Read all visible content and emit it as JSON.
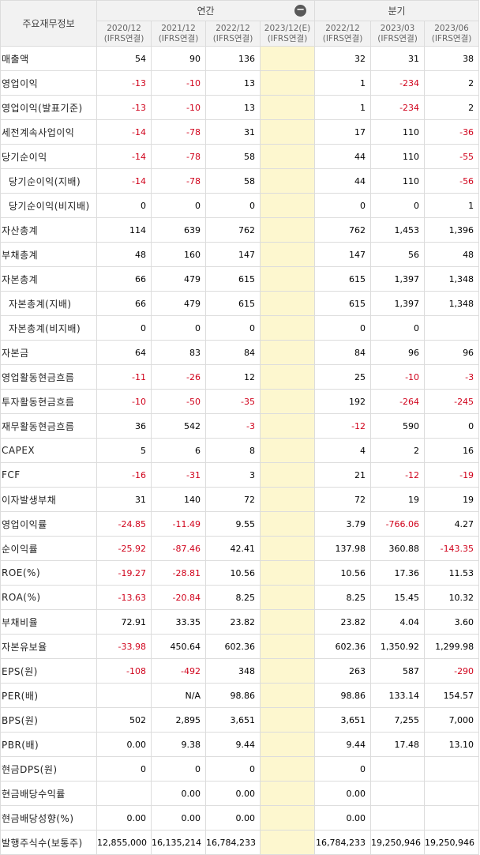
{
  "header": {
    "title": "주요재무정보",
    "annual_label": "연간",
    "quarter_label": "분기",
    "collapse_icon": "minus-circle-icon",
    "periods": [
      {
        "date": "2020/12",
        "basis": "(IFRS연결)"
      },
      {
        "date": "2021/12",
        "basis": "(IFRS연결)"
      },
      {
        "date": "2022/12",
        "basis": "(IFRS연결)"
      },
      {
        "date": "2023/12(E)",
        "basis": "(IFRS연결)"
      },
      {
        "date": "2022/12",
        "basis": "(IFRS연결)"
      },
      {
        "date": "2023/03",
        "basis": "(IFRS연결)"
      },
      {
        "date": "2023/06",
        "basis": "(IFRS연결)"
      }
    ]
  },
  "colors": {
    "negative": "#d0021b",
    "estimate_bg": "#fdf7cf",
    "header_bg": "#f2f2f2"
  },
  "rows": [
    {
      "label": "매출액",
      "indent": false,
      "values": [
        "54",
        "90",
        "136",
        "",
        "32",
        "31",
        "38"
      ]
    },
    {
      "label": "영업이익",
      "indent": false,
      "values": [
        "-13",
        "-10",
        "13",
        "",
        "1",
        "-234",
        "2"
      ]
    },
    {
      "label": "영업이익(발표기준)",
      "indent": false,
      "values": [
        "-13",
        "-10",
        "13",
        "",
        "1",
        "-234",
        "2"
      ]
    },
    {
      "label": "세전계속사업이익",
      "indent": false,
      "values": [
        "-14",
        "-78",
        "31",
        "",
        "17",
        "110",
        "-36"
      ]
    },
    {
      "label": "당기순이익",
      "indent": false,
      "values": [
        "-14",
        "-78",
        "58",
        "",
        "44",
        "110",
        "-55"
      ]
    },
    {
      "label": "당기순이익(지배)",
      "indent": true,
      "values": [
        "-14",
        "-78",
        "58",
        "",
        "44",
        "110",
        "-56"
      ]
    },
    {
      "label": "당기순이익(비지배)",
      "indent": true,
      "values": [
        "0",
        "0",
        "0",
        "",
        "0",
        "0",
        "1"
      ]
    },
    {
      "label": "자산총계",
      "indent": false,
      "values": [
        "114",
        "639",
        "762",
        "",
        "762",
        "1,453",
        "1,396"
      ]
    },
    {
      "label": "부채총계",
      "indent": false,
      "values": [
        "48",
        "160",
        "147",
        "",
        "147",
        "56",
        "48"
      ]
    },
    {
      "label": "자본총계",
      "indent": false,
      "values": [
        "66",
        "479",
        "615",
        "",
        "615",
        "1,397",
        "1,348"
      ]
    },
    {
      "label": "자본총계(지배)",
      "indent": true,
      "values": [
        "66",
        "479",
        "615",
        "",
        "615",
        "1,397",
        "1,348"
      ]
    },
    {
      "label": "자본총계(비지배)",
      "indent": true,
      "values": [
        "0",
        "0",
        "0",
        "",
        "0",
        "0",
        ""
      ]
    },
    {
      "label": "자본금",
      "indent": false,
      "values": [
        "64",
        "83",
        "84",
        "",
        "84",
        "96",
        "96"
      ]
    },
    {
      "label": "영업활동현금흐름",
      "indent": false,
      "values": [
        "-11",
        "-26",
        "12",
        "",
        "25",
        "-10",
        "-3"
      ]
    },
    {
      "label": "투자활동현금흐름",
      "indent": false,
      "values": [
        "-10",
        "-50",
        "-35",
        "",
        "192",
        "-264",
        "-245"
      ]
    },
    {
      "label": "재무활동현금흐름",
      "indent": false,
      "values": [
        "36",
        "542",
        "-3",
        "",
        "-12",
        "590",
        "0"
      ]
    },
    {
      "label": "CAPEX",
      "indent": false,
      "values": [
        "5",
        "6",
        "8",
        "",
        "4",
        "2",
        "16"
      ]
    },
    {
      "label": "FCF",
      "indent": false,
      "values": [
        "-16",
        "-31",
        "3",
        "",
        "21",
        "-12",
        "-19"
      ]
    },
    {
      "label": "이자발생부채",
      "indent": false,
      "values": [
        "31",
        "140",
        "72",
        "",
        "72",
        "19",
        "19"
      ]
    },
    {
      "label": "영업이익률",
      "indent": false,
      "values": [
        "-24.85",
        "-11.49",
        "9.55",
        "",
        "3.79",
        "-766.06",
        "4.27"
      ]
    },
    {
      "label": "순이익률",
      "indent": false,
      "values": [
        "-25.92",
        "-87.46",
        "42.41",
        "",
        "137.98",
        "360.88",
        "-143.35"
      ]
    },
    {
      "label": "ROE(%)",
      "indent": false,
      "values": [
        "-19.27",
        "-28.81",
        "10.56",
        "",
        "10.56",
        "17.36",
        "11.53"
      ]
    },
    {
      "label": "ROA(%)",
      "indent": false,
      "values": [
        "-13.63",
        "-20.84",
        "8.25",
        "",
        "8.25",
        "15.45",
        "10.32"
      ]
    },
    {
      "label": "부채비율",
      "indent": false,
      "values": [
        "72.91",
        "33.35",
        "23.82",
        "",
        "23.82",
        "4.04",
        "3.60"
      ]
    },
    {
      "label": "자본유보율",
      "indent": false,
      "values": [
        "-33.98",
        "450.64",
        "602.36",
        "",
        "602.36",
        "1,350.92",
        "1,299.98"
      ]
    },
    {
      "label": "EPS(원)",
      "indent": false,
      "values": [
        "-108",
        "-492",
        "348",
        "",
        "263",
        "587",
        "-290"
      ]
    },
    {
      "label": "PER(배)",
      "indent": false,
      "values": [
        "",
        "N/A",
        "98.86",
        "",
        "98.86",
        "133.14",
        "154.57"
      ]
    },
    {
      "label": "BPS(원)",
      "indent": false,
      "values": [
        "502",
        "2,895",
        "3,651",
        "",
        "3,651",
        "7,255",
        "7,000"
      ]
    },
    {
      "label": "PBR(배)",
      "indent": false,
      "values": [
        "0.00",
        "9.38",
        "9.44",
        "",
        "9.44",
        "17.48",
        "13.10"
      ]
    },
    {
      "label": "현금DPS(원)",
      "indent": false,
      "values": [
        "0",
        "0",
        "0",
        "",
        "0",
        "",
        ""
      ]
    },
    {
      "label": "현금배당수익률",
      "indent": false,
      "values": [
        "",
        "0.00",
        "0.00",
        "",
        "0.00",
        "",
        ""
      ]
    },
    {
      "label": "현금배당성향(%)",
      "indent": false,
      "values": [
        "0.00",
        "0.00",
        "0.00",
        "",
        "0.00",
        "",
        ""
      ]
    },
    {
      "label": "발행주식수(보통주)",
      "indent": false,
      "values": [
        "12,855,000",
        "16,135,214",
        "16,784,233",
        "",
        "16,784,233",
        "19,250,946",
        "19,250,946"
      ]
    }
  ]
}
